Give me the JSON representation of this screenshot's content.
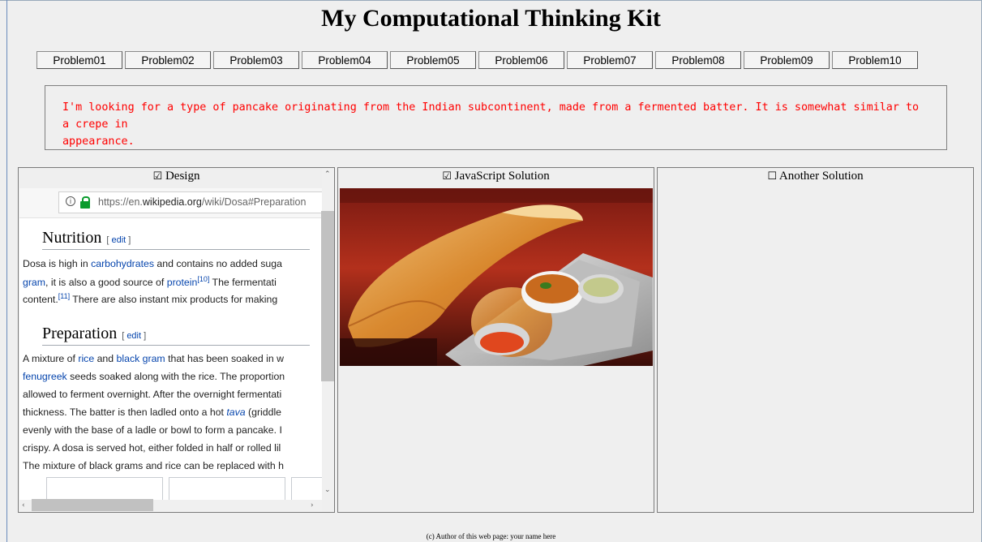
{
  "page": {
    "title": "My Computational Thinking Kit"
  },
  "tabs": [
    "Problem01",
    "Problem02",
    "Problem03",
    "Problem04",
    "Problem05",
    "Problem06",
    "Problem07",
    "Problem08",
    "Problem09",
    "Problem10"
  ],
  "problem": {
    "line1": "I'm looking for a type of pancake originating from the Indian subcontinent, made from a fermented batter. It is somewhat similar to a crepe in",
    "line2": "appearance."
  },
  "panels": {
    "design": {
      "checkbox": "☑",
      "label": "Design"
    },
    "js": {
      "checkbox": "☑",
      "label": "JavaScript Solution"
    },
    "another": {
      "checkbox": "☐",
      "label": "Another Solution"
    }
  },
  "design_view": {
    "url_prefix": "https://en.",
    "url_domain": "wikipedia.org",
    "url_path": "/wiki/Dosa#Preparation",
    "nutrition_heading": "Nutrition",
    "edit_label": "edit",
    "nutrition": {
      "l1a": "Dosa is high in ",
      "l1_link": "carbohydrates",
      "l1b": " and contains no added suga",
      "l2_link": "gram",
      "l2a": ", it is also a good source of ",
      "l2_link2": "protein",
      "l2_ref": "[10]",
      "l2b": " The fermentati",
      "l3a": "content.",
      "l3_ref": "[11]",
      "l3b": " There are also instant mix products for making"
    },
    "preparation_heading": "Preparation",
    "preparation": {
      "l1a": "A mixture of ",
      "l1_link": "rice",
      "l1b": " and ",
      "l1_link2": "black gram",
      "l1c": " that has been soaked in w",
      "l2_link": "fenugreek",
      "l2a": " seeds soaked along with the rice. The proportion",
      "l3": "allowed to ferment overnight. After the overnight fermentati",
      "l4a": "thickness. The batter is then ladled onto a hot ",
      "l4_link": "tava",
      "l4b": " (griddle",
      "l5": "evenly with the base of a ladle or bowl to form a pancake. I",
      "l6": "crispy. A dosa is served hot, either folded in half or rolled lil",
      "l7": "The mixture of black grams and rice can be replaced with h"
    }
  },
  "footer": "(c) Author of this web page: your name here",
  "colors": {
    "problem_text": "#ff0000",
    "link": "#0645ad",
    "lock": "#0a9b2d"
  }
}
